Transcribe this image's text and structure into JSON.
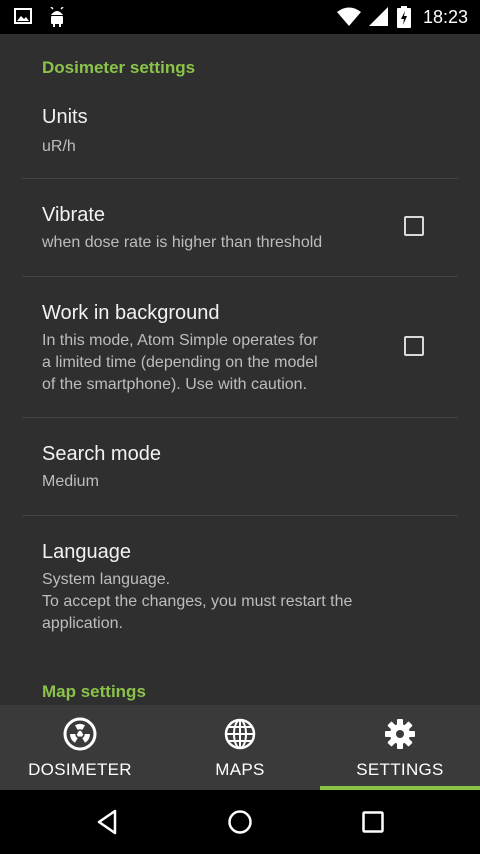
{
  "status_bar": {
    "time": "18:23",
    "icons": [
      "image-icon",
      "android-icon",
      "wifi-icon",
      "signal-icon",
      "battery-charging-icon"
    ]
  },
  "settings": {
    "dosimeter_header": "Dosimeter settings",
    "units": {
      "title": "Units",
      "summary": "uR/h"
    },
    "vibrate": {
      "title": "Vibrate",
      "summary": "when dose rate is higher than threshold",
      "checked": false
    },
    "background": {
      "title": "Work in background",
      "summary_lines": [
        "In this mode, Atom Simple operates for",
        "a limited time (depending on the model",
        "of the smartphone). Use with caution."
      ],
      "checked": false
    },
    "search_mode": {
      "title": "Search mode",
      "summary": "Medium"
    },
    "language": {
      "title": "Language",
      "summary_lines": [
        "System language.",
        "To accept the changes, you must restart the",
        "application."
      ]
    },
    "map_header": "Map settings"
  },
  "tabs": [
    {
      "label": "DOSIMETER",
      "icon": "radiation-icon",
      "selected": false
    },
    {
      "label": "MAPS",
      "icon": "globe-icon",
      "selected": false
    },
    {
      "label": "SETTINGS",
      "icon": "gear-icon",
      "selected": true
    }
  ],
  "colors": {
    "accent": "#8bc34a",
    "background": "#2f2f2f",
    "tab_bar": "#3a3a3a"
  },
  "nav_bar": {
    "buttons": [
      "back-icon",
      "home-icon",
      "recents-icon"
    ]
  }
}
